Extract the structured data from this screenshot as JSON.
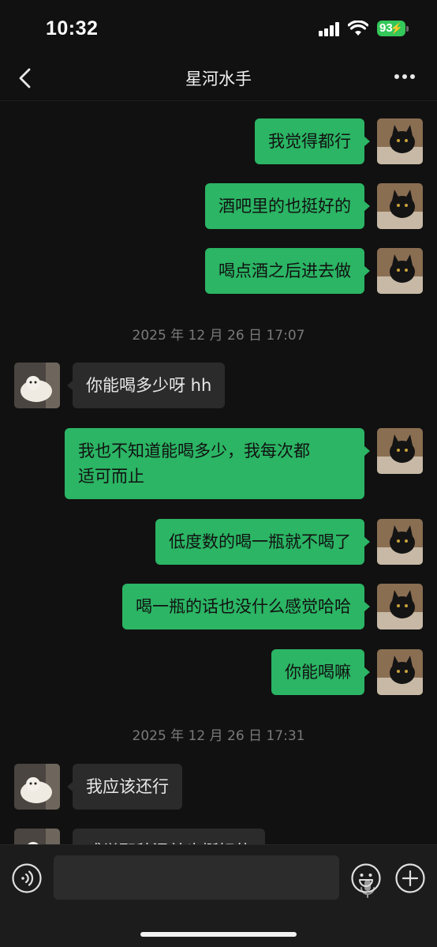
{
  "status": {
    "time": "10:32",
    "battery": "93"
  },
  "nav": {
    "title": "星河水手"
  },
  "conversation": {
    "messages": [
      {
        "text": "我觉得都行"
      },
      {
        "text": "酒吧里的也挺好的"
      },
      {
        "text": "喝点酒之后进去做"
      },
      {
        "timestamp": "2025 年 12 月 26 日 17:07"
      },
      {
        "text": "你能喝多少呀 hh"
      },
      {
        "text": "我也不知道能喝多少，我每次都\n适可而止"
      },
      {
        "text": "低度数的喝一瓶就不喝了"
      },
      {
        "text": "喝一瓶的话也没什么感觉哈哈"
      },
      {
        "text": "你能喝嘛"
      },
      {
        "timestamp": "2025 年 12 月 26 日 17:31"
      },
      {
        "text": "我应该还行"
      },
      {
        "text": "感觉那种混兑也挺好的"
      }
    ]
  },
  "colors": {
    "outgoing_bubble": "#2bb564",
    "incoming_bubble": "#2b2b2b",
    "background": "#111111",
    "battery": "#34c759"
  },
  "icons": [
    "back-icon",
    "more-icon",
    "voice-icon",
    "mic-icon",
    "emoji-icon",
    "plus-icon"
  ]
}
